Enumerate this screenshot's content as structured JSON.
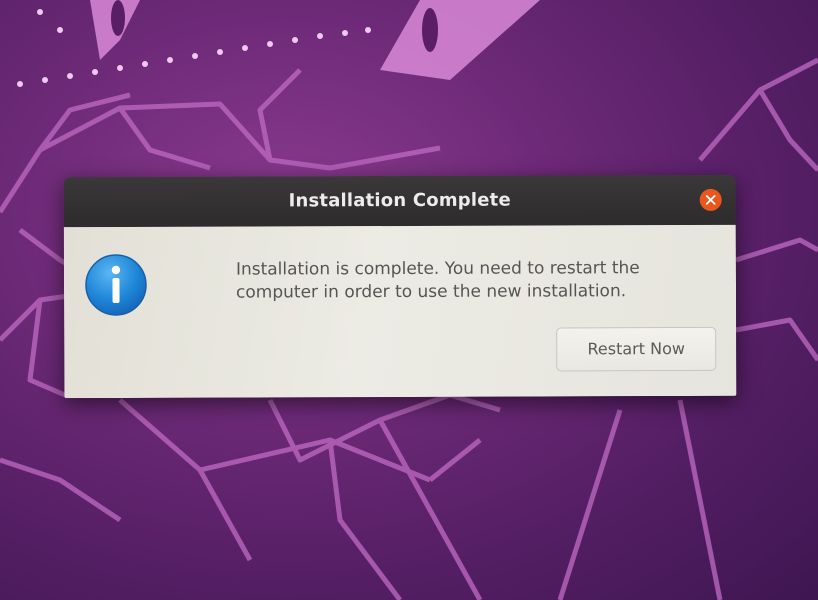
{
  "wallpaper": {
    "accent": "#c06bc4"
  },
  "dialog": {
    "title": "Installation Complete",
    "close_icon": "close-icon",
    "info_icon": "info-icon",
    "message_line1": "Installation is complete. You need to restart the",
    "message_line2": "computer in order to use the new installation.",
    "restart_label": "Restart Now"
  },
  "colors": {
    "titlebar": "#2d2b2b",
    "close_button": "#e9561e",
    "info_icon": "#1e86d8",
    "dialog_body": "#e8e7df"
  }
}
